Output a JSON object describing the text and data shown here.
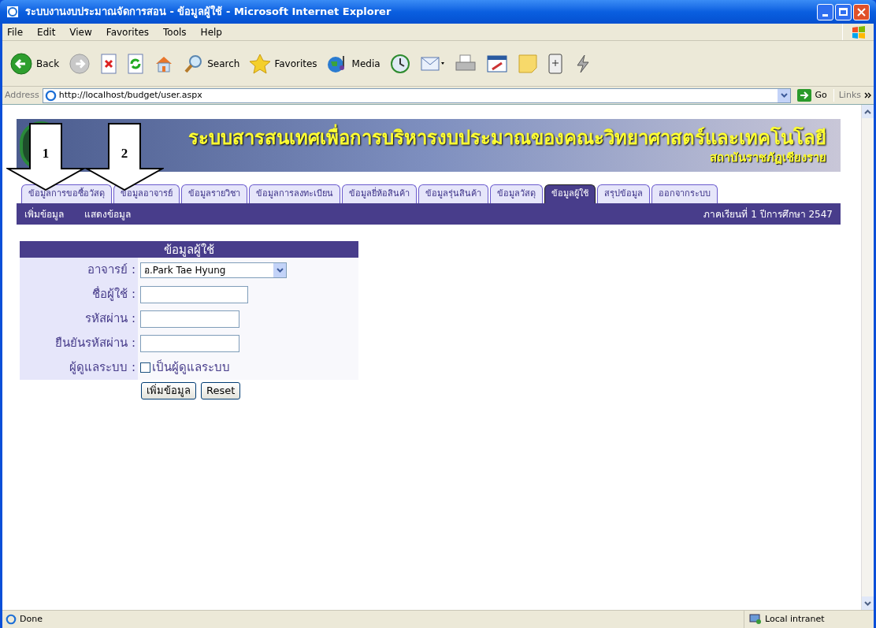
{
  "window": {
    "title": "ระบบงานงบประมาณจัดการสอน - ข้อมูลผู้ใช้ - Microsoft Internet Explorer"
  },
  "menu": [
    "File",
    "Edit",
    "View",
    "Favorites",
    "Tools",
    "Help"
  ],
  "toolbar": [
    {
      "kind": "back",
      "label": "Back"
    },
    {
      "kind": "forward"
    },
    {
      "kind": "stop"
    },
    {
      "kind": "refresh"
    },
    {
      "kind": "home"
    },
    {
      "kind": "search",
      "label": "Search"
    },
    {
      "kind": "favorites",
      "label": "Favorites"
    },
    {
      "kind": "media",
      "label": "Media"
    },
    {
      "kind": "history"
    },
    {
      "kind": "mail"
    },
    {
      "kind": "print"
    },
    {
      "kind": "edit"
    },
    {
      "kind": "note"
    },
    {
      "kind": "messenger"
    },
    {
      "kind": "flash"
    }
  ],
  "address": {
    "label": "Address",
    "url": "http://localhost/budget/user.aspx",
    "go": "Go",
    "links": "Links"
  },
  "banner": {
    "title": "ระบบสารสนเทศเพื่อการบริหารงบประมาณของคณะวิทยาศาสตร์และเทคโนโลยี",
    "subtitle": "สถาบันราชภัฏเชียงราย"
  },
  "callouts": [
    "1",
    "2"
  ],
  "tabs": [
    {
      "label": "ข้อมูลการขอซื้อวัสดุ",
      "selected": false
    },
    {
      "label": "ข้อมูลอาจารย์",
      "selected": false
    },
    {
      "label": "ข้อมูลรายวิชา",
      "selected": false
    },
    {
      "label": "ข้อมูลการลงทะเบียน",
      "selected": false
    },
    {
      "label": "ข้อมูลยี่ห้อสินค้า",
      "selected": false
    },
    {
      "label": "ข้อมูลรุ่นสินค้า",
      "selected": false
    },
    {
      "label": "ข้อมูลวัสดุ",
      "selected": false
    },
    {
      "label": "ข้อมูลผู้ใช้",
      "selected": true
    },
    {
      "label": "สรุปข้อมูล",
      "selected": false
    },
    {
      "label": "ออกจากระบบ",
      "selected": false
    }
  ],
  "subnav": {
    "links": [
      "เพิ่มข้อมูล",
      "แสดงข้อมูล"
    ],
    "term": "ภาคเรียนที่ 1 ปีการศึกษา 2547"
  },
  "form": {
    "title": "ข้อมูลผู้ใช้",
    "fields": [
      {
        "kind": "select",
        "label": "อาจารย์ :",
        "value": "อ.Park Tae Hyung"
      },
      {
        "kind": "text",
        "label": "ชื่อผู้ใช้ :"
      },
      {
        "kind": "password",
        "label": "รหัสผ่าน :"
      },
      {
        "kind": "password",
        "label": "ยืนยันรหัสผ่าน :"
      },
      {
        "kind": "checkbox",
        "label": "ผู้ดูแลระบบ :",
        "option": "เป็นผู้ดูแลระบบ",
        "checked": false
      }
    ],
    "buttons": [
      "เพิ่มข้อมูล",
      "Reset"
    ]
  },
  "status": {
    "text": "Done",
    "zone": "Local intranet"
  }
}
